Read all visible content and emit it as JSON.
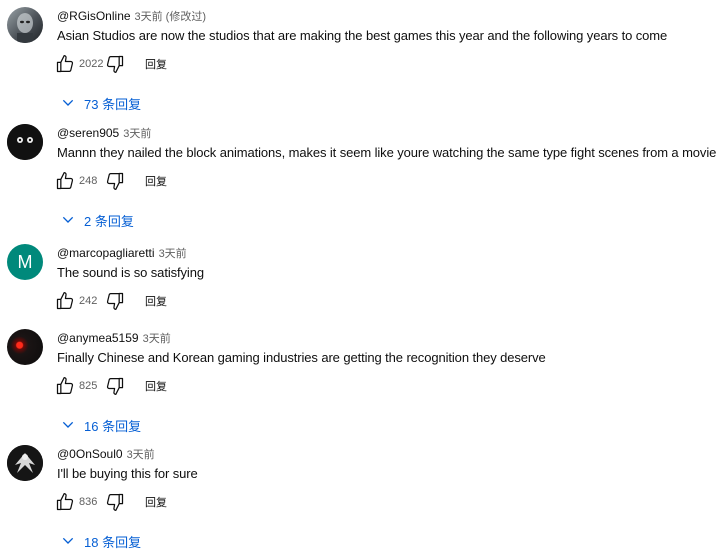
{
  "comments": [
    {
      "author": "@RGisOnline",
      "time": "3天前",
      "edited": "(修改过)",
      "text": "Asian Studios are now the studios that are making the best games this year and the following years to come",
      "likes": "2022",
      "reply_label": "回复",
      "replies": "73 条回复",
      "avatar": "stone-portrait"
    },
    {
      "author": "@seren905",
      "time": "3天前",
      "text": "Mannn they nailed the block animations, makes it seem like youre watching the same type fight scenes from a movie",
      "likes": "248",
      "reply_label": "回复",
      "replies": "2 条回复",
      "avatar": "dark-face"
    },
    {
      "author": "@marcopagliaretti",
      "time": "3天前",
      "text": "The sound is so satisfying",
      "likes": "242",
      "reply_label": "回复",
      "avatar_letter": "M",
      "avatar": "letter-m"
    },
    {
      "author": "@anymea5159",
      "time": "3天前",
      "text": "Finally Chinese and Korean gaming industries are getting the recognition they deserve",
      "likes": "825",
      "reply_label": "回复",
      "replies": "16 条回复",
      "avatar": "red-eye"
    },
    {
      "author": "@0OnSoul0",
      "time": "3天前",
      "text": "I'll be buying this for sure",
      "likes": "836",
      "reply_label": "回复",
      "replies": "18 条回复",
      "avatar": "winged-figure"
    }
  ],
  "colors": {
    "link": "#065fd4",
    "meta": "#606060",
    "text": "#0f0f0f",
    "avatar_letter_bg": "#00897b"
  },
  "icons": {
    "like": "thumb-up-icon",
    "dislike": "thumb-down-icon",
    "expand": "chevron-down-icon"
  }
}
